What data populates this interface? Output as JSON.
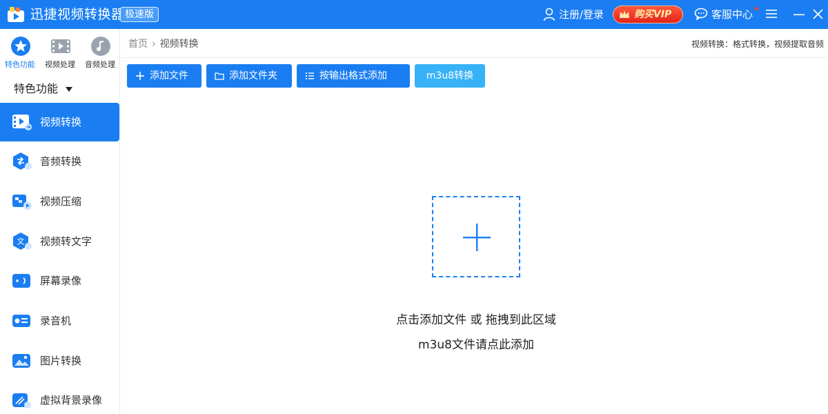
{
  "app": {
    "title": "迅捷视频转换器",
    "badge": "极速版"
  },
  "header": {
    "login": "注册/登录",
    "vip": "购买VIP",
    "service": "客服中心"
  },
  "categories": [
    {
      "label": "特色功能",
      "icon": "star-icon",
      "active": true
    },
    {
      "label": "视频处理",
      "icon": "film-icon",
      "active": false
    },
    {
      "label": "音频处理",
      "icon": "music-disc-icon",
      "active": false
    }
  ],
  "sidebar": {
    "section_title": "特色功能",
    "items": [
      {
        "label": "视频转换",
        "icon": "video-convert-icon",
        "active": true
      },
      {
        "label": "音频转换",
        "icon": "audio-convert-icon",
        "active": false
      },
      {
        "label": "视频压缩",
        "icon": "video-compress-icon",
        "active": false
      },
      {
        "label": "视频转文字",
        "icon": "video-to-text-icon",
        "active": false
      },
      {
        "label": "屏幕录像",
        "icon": "screen-record-icon",
        "active": false
      },
      {
        "label": "录音机",
        "icon": "recorder-icon",
        "active": false
      },
      {
        "label": "图片转换",
        "icon": "image-convert-icon",
        "active": false
      },
      {
        "label": "虚拟背景录像",
        "icon": "virtual-background-icon",
        "active": false
      }
    ]
  },
  "breadcrumb": {
    "home": "首页",
    "current": "视频转换"
  },
  "hint": "视频转换：格式转换，视频提取音频",
  "toolbar": {
    "add_file": "添加文件",
    "add_folder": "添加文件夹",
    "add_by_format": "按输出格式添加",
    "m3u8": "m3u8转换"
  },
  "dropzone": {
    "line1": "点击添加文件 或 拖拽到此区域",
    "line2": "m3u8文件请点此添加"
  },
  "colors": {
    "primary": "#1a7ef2",
    "light_button": "#38b2f7",
    "vip": "#e3231a"
  }
}
